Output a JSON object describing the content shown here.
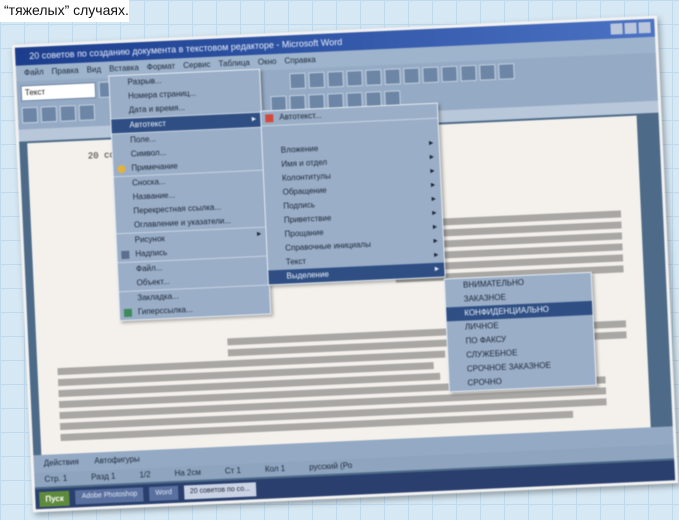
{
  "caption": "“тяжелых” случаях.",
  "window": {
    "title": "20 советов по созданию документа в текстовом редакторе - Microsoft Word"
  },
  "menubar": [
    "Файл",
    "Правка",
    "Вид",
    "Вставка",
    "Формат",
    "Сервис",
    "Таблица",
    "Окно",
    "Справка"
  ],
  "toolbar": {
    "font_style": "Текст"
  },
  "insert_menu": {
    "items": [
      {
        "label": "Разрыв...",
        "highlighted": false
      },
      {
        "label": "Номера страниц...",
        "highlighted": false
      },
      {
        "label": "Дата и время...",
        "highlighted": false
      },
      {
        "label": "Автотекст",
        "highlighted": true,
        "submenu": true
      },
      {
        "label": "Поле...",
        "highlighted": false
      },
      {
        "label": "Символ...",
        "highlighted": false
      },
      {
        "label": "Примечание",
        "highlighted": false
      },
      {
        "label": "Сноска...",
        "highlighted": false
      },
      {
        "label": "Название...",
        "highlighted": false
      },
      {
        "label": "Перекрестная ссылка...",
        "highlighted": false
      },
      {
        "label": "Оглавление и указатели...",
        "highlighted": false
      },
      {
        "label": "Рисунок",
        "highlighted": false,
        "submenu": true
      },
      {
        "label": "Надпись",
        "highlighted": false
      },
      {
        "label": "Файл...",
        "highlighted": false
      },
      {
        "label": "Объект...",
        "highlighted": false
      },
      {
        "label": "Закладка...",
        "highlighted": false
      },
      {
        "label": "Гиперссылка...",
        "highlighted": false
      }
    ]
  },
  "autotext_menu": {
    "items": [
      {
        "label": "Автотекст...",
        "highlighted": false
      },
      {
        "label": "Вложение",
        "highlighted": false,
        "submenu": true
      },
      {
        "label": "Имя и отдел",
        "highlighted": false,
        "submenu": true
      },
      {
        "label": "Колонтитулы",
        "highlighted": false,
        "submenu": true
      },
      {
        "label": "Обращение",
        "highlighted": false,
        "submenu": true
      },
      {
        "label": "Подпись",
        "highlighted": false,
        "submenu": true
      },
      {
        "label": "Приветствие",
        "highlighted": false,
        "submenu": true
      },
      {
        "label": "Прощание",
        "highlighted": false,
        "submenu": true
      },
      {
        "label": "Справочные инициалы",
        "highlighted": false,
        "submenu": true
      },
      {
        "label": "Текст",
        "highlighted": false,
        "submenu": true
      },
      {
        "label": "Выделение",
        "highlighted": true,
        "submenu": true
      }
    ]
  },
  "highlight_menu": {
    "items": [
      {
        "label": "ВНИМАТЕЛЬНО",
        "highlighted": false
      },
      {
        "label": "ЗАКАЗНОЕ",
        "highlighted": false
      },
      {
        "label": "КОНФИДЕНЦИАЛЬНО",
        "highlighted": true
      },
      {
        "label": "ЛИЧНОЕ",
        "highlighted": false
      },
      {
        "label": "ПО ФАКСУ",
        "highlighted": false
      },
      {
        "label": "СЛУЖЕБНОЕ",
        "highlighted": false
      },
      {
        "label": "СРОЧНОЕ ЗАКАЗНОЕ",
        "highlighted": false
      },
      {
        "label": "СРОЧНО",
        "highlighted": false
      }
    ]
  },
  "document": {
    "heading": "20 советов"
  },
  "drawing_bar": {
    "label": "Действия",
    "autoshapes": "Автофигуры"
  },
  "statusbar": [
    "Стр. 1",
    "Разд 1",
    "1/2",
    "На 2см",
    "Ст 1",
    "Кол 1",
    "русский (Ро"
  ],
  "taskbar": {
    "start": "Пуск",
    "tasks": [
      {
        "label": "Adobe Photoshop",
        "active": false
      },
      {
        "label": "Word",
        "active": false
      },
      {
        "label": "20 советов по со...",
        "active": true
      }
    ]
  }
}
